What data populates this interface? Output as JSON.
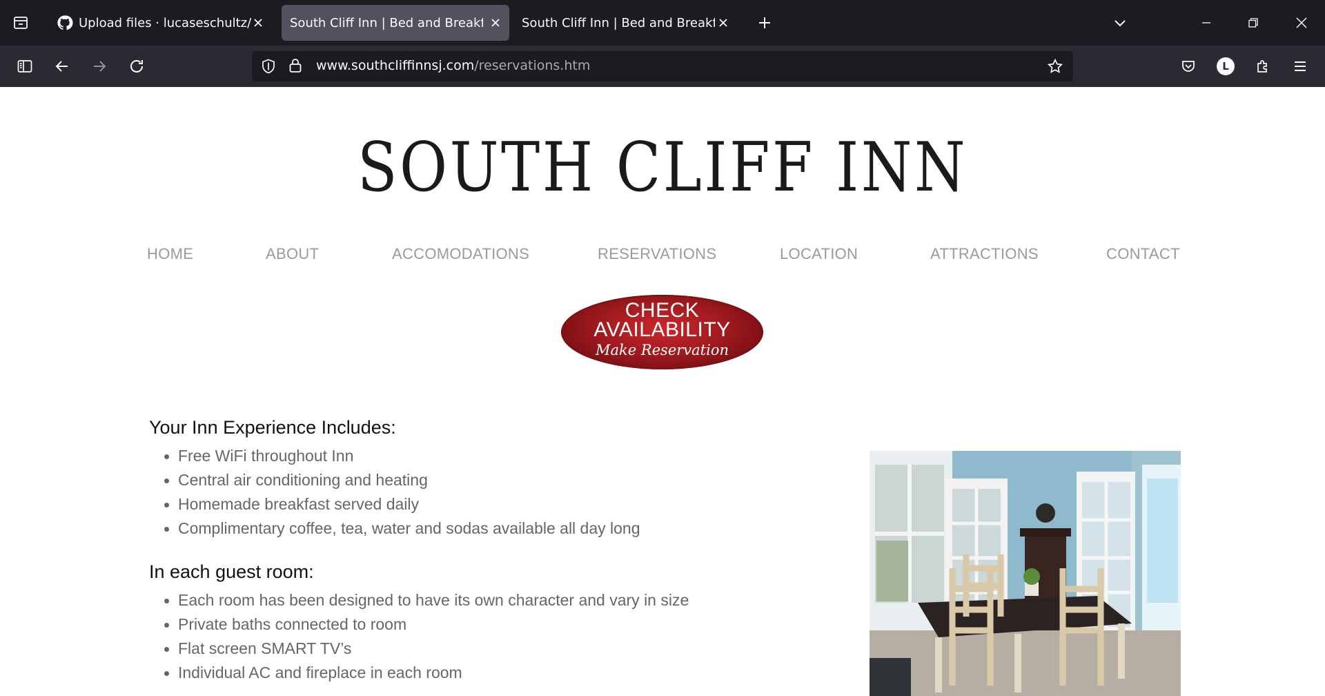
{
  "browser": {
    "tabs": [
      {
        "title": "Upload files · lucaseschultz/HTML",
        "icon": "github-icon",
        "active": false
      },
      {
        "title": "South Cliff Inn | Bed and Breakfast |",
        "icon": "none",
        "active": true
      },
      {
        "title": "South Cliff Inn | Bed and Breakfast |",
        "icon": "none",
        "active": false
      }
    ],
    "url_domain": "www.southcliffinnsj.com",
    "url_path": "/reservations.htm",
    "profile_initial": "L"
  },
  "site": {
    "logo": "SOUTH CLIFF INN",
    "menu": [
      "HOME",
      "ABOUT",
      "ACCOMODATIONS",
      "RESERVATIONS",
      "LOCATION",
      "ATTRACTIONS",
      "CONTACT"
    ],
    "cta": {
      "line1": "CHECK",
      "line2": "AVAILABILITY",
      "line3": "Make Reservation"
    }
  },
  "content": {
    "section1": {
      "heading": "Your Inn Experience Includes:",
      "items": [
        "Free WiFi throughout Inn",
        "Central air conditioning and heating",
        "Homemade breakfast served daily",
        "Complimentary coffee, tea, water and sodas available all day long"
      ]
    },
    "section2": {
      "heading": "In each guest room:",
      "items": [
        "Each room has been designed to have its own character and vary in size",
        "Private baths connected to room",
        "Flat screen SMART TV’s",
        "Individual AC and fireplace in each room"
      ]
    }
  },
  "colors": {
    "tabbar_bg": "#1c1b22",
    "navbar_bg": "#2b2a33",
    "menu_text": "#9a9a9a",
    "cta_red": "#a01a1f"
  }
}
